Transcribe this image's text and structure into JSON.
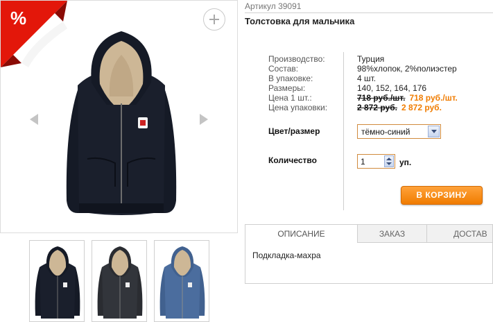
{
  "badge": {
    "label": "%"
  },
  "product": {
    "sku_label": "Артикул 39091",
    "title": "Толстовка для мальчика"
  },
  "specs": {
    "labels": [
      "Производство:",
      "Состав:",
      "В упаковке:",
      "Размеры:",
      "Цена 1 шт.:",
      "Цена упаковки:"
    ],
    "country": "Турция",
    "composition": "98%хлопок, 2%полиэстер",
    "pack": "4 шт.",
    "sizes": "140, 152, 164, 176",
    "price_unit_old": "718 руб./шт.",
    "price_unit_new": "718 руб./шт.",
    "price_pack_old": "2 872 руб.",
    "price_pack_new": "2 872 руб."
  },
  "options": {
    "color_label": "Цвет/размер",
    "color_value": "тёмно-синий",
    "qty_label": "Количество",
    "qty_value": "1",
    "qty_unit": "уп."
  },
  "cart": {
    "button_label": "В КОРЗИНУ"
  },
  "tabs": [
    {
      "label": "ОПИСАНИЕ"
    },
    {
      "label": "ЗАКАЗ"
    },
    {
      "label": "ДОСТАВ"
    }
  ],
  "description": "Подкладка-махра",
  "colors": {
    "accent": "#f07c00",
    "ribbon": "#e3170a",
    "hoodie_navy": "#151a26",
    "hoodie_graphite": "#2a2c31",
    "hoodie_blue": "#4b6d9e",
    "lining": "#cdb796"
  },
  "thumbnails": [
    {
      "icon": "hoodie-navy-thumbnail"
    },
    {
      "icon": "hoodie-graphite-thumbnail"
    },
    {
      "icon": "hoodie-blue-thumbnail"
    }
  ]
}
